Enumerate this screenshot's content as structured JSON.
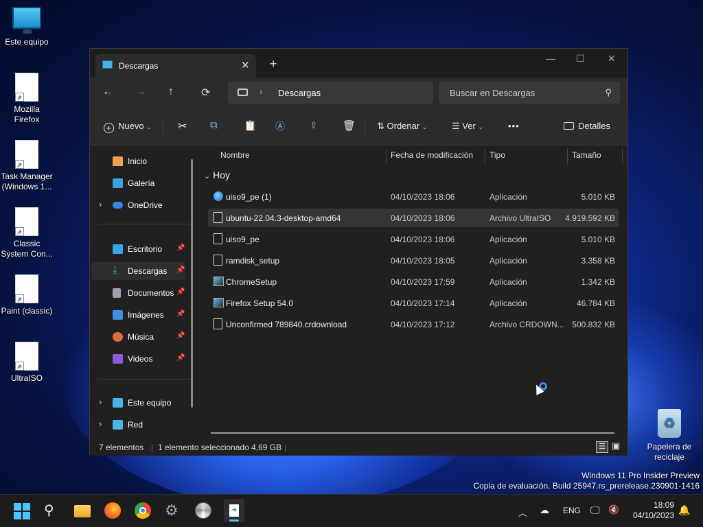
{
  "desktop": {
    "icons": [
      {
        "label": "Este equipo",
        "icon": "computer-icon"
      },
      {
        "label": "Mozilla Firefox",
        "icon": "shortcut-file-icon"
      },
      {
        "label": "Task Manager (Windows 1...",
        "icon": "shortcut-file-icon"
      },
      {
        "label": "Classic System Con...",
        "icon": "shortcut-file-icon"
      },
      {
        "label": "Paint (classic)",
        "icon": "shortcut-file-icon"
      },
      {
        "label": "UltraISO",
        "icon": "shortcut-file-icon"
      },
      {
        "label": "Papelera de reciclaje",
        "icon": "recycle-bin-icon"
      }
    ],
    "watermark_line1": "Windows 11 Pro Insider Preview",
    "watermark_line2": "Copia de evaluación. Build 25947.rs_prerelease.230901-1416"
  },
  "window": {
    "tab_title": "Descargas",
    "close_tab": "✕",
    "new_tab": "+",
    "controls": {
      "minimize": "—",
      "maximize": "☐",
      "close": "✕"
    },
    "nav": {
      "back": "←",
      "forward": "→",
      "up": "↑",
      "refresh": "⟳"
    },
    "address": {
      "separator": "›",
      "crumb": "Descargas"
    },
    "search_placeholder": "Buscar en Descargas",
    "toolbar": {
      "new_label": "Nuevo",
      "sort_label": "Ordenar",
      "view_label": "Ver",
      "more": "•••",
      "details_label": "Detalles"
    },
    "sidebar": {
      "items": [
        {
          "label": "Inicio",
          "color": "#f0a050"
        },
        {
          "label": "Galería",
          "color": "#3fa0e8"
        },
        {
          "label": "OneDrive",
          "color": "#2e8de0"
        },
        {
          "label": "Escritorio",
          "color": "#3aa6e6"
        },
        {
          "label": "Descargas",
          "color": "#36b37e"
        },
        {
          "label": "Documentos",
          "color": "#9aa3ad"
        },
        {
          "label": "Imágenes",
          "color": "#3f8ee8"
        },
        {
          "label": "Música",
          "color": "#e06a3b"
        },
        {
          "label": "Videos",
          "color": "#8a5ad8"
        },
        {
          "label": "Este equipo",
          "color": "#4bb4e6"
        },
        {
          "label": "Red",
          "color": "#4bb4e6"
        }
      ]
    },
    "columns": {
      "name": "Nombre",
      "date": "Fecha de modificación",
      "type": "Tipo",
      "size": "Tamaño"
    },
    "group_label": "Hoy",
    "files": [
      {
        "name": "uiso9_pe (1)",
        "date": "04/10/2023 18:06",
        "type": "Aplicación",
        "size": "5.010 KB",
        "icon": "globe-app-icon"
      },
      {
        "name": "ubuntu-22.04.3-desktop-amd64",
        "date": "04/10/2023 18:06",
        "type": "Archivo UltraISO",
        "size": "4.919.592 KB",
        "icon": "file-icon"
      },
      {
        "name": "uiso9_pe",
        "date": "04/10/2023 18:06",
        "type": "Aplicación",
        "size": "5.010 KB",
        "icon": "file-icon"
      },
      {
        "name": "ramdisk_setup",
        "date": "04/10/2023 18:05",
        "type": "Aplicación",
        "size": "3.358 KB",
        "icon": "file-icon"
      },
      {
        "name": "ChromeSetup",
        "date": "04/10/2023 17:59",
        "type": "Aplicación",
        "size": "1.342 KB",
        "icon": "installer-icon"
      },
      {
        "name": "Firefox Setup 54.0",
        "date": "04/10/2023 17:14",
        "type": "Aplicación",
        "size": "46.784 KB",
        "icon": "installer-icon"
      },
      {
        "name": "Unconfirmed 789840.crdownload",
        "date": "04/10/2023 17:12",
        "type": "Archivo CRDOWN...",
        "size": "500.832 KB",
        "icon": "file-icon"
      }
    ],
    "status": {
      "count": "7 elementos",
      "selection": "1 elemento seleccionado  4,69 GB"
    }
  },
  "taskbar": {
    "lang": "ENG",
    "time": "18:09",
    "date": "04/10/2023"
  }
}
